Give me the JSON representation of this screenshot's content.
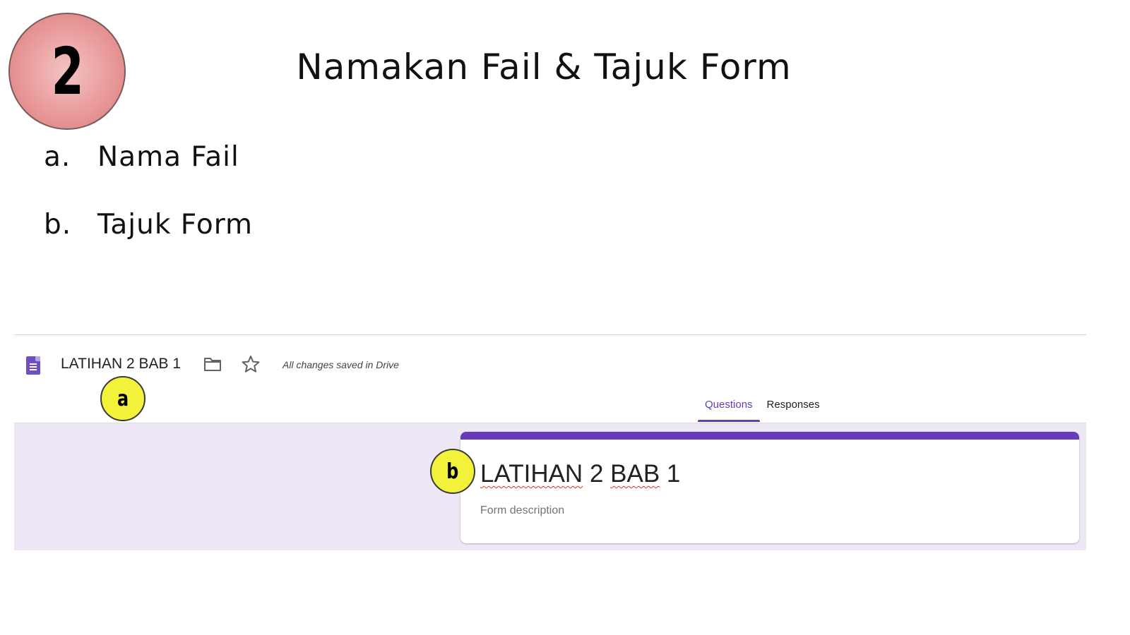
{
  "slide": {
    "step_number": "2",
    "title": "Namakan Fail & Tajuk Form",
    "steps": [
      {
        "marker": "a.",
        "text": "Nama Fail"
      },
      {
        "marker": "b.",
        "text": "Tajuk Form"
      }
    ]
  },
  "forms_screenshot": {
    "header": {
      "app_icon": "google-forms-icon",
      "document_name": "LATIHAN 2 BAB 1",
      "folder_icon": "folder-icon",
      "star_icon": "star-icon",
      "save_status": "All changes saved in Drive"
    },
    "tabs": [
      {
        "label": "Questions",
        "active": true
      },
      {
        "label": "Responses",
        "active": false
      }
    ],
    "form_card": {
      "title_part1": "LATIHAN",
      "title_part2": " 2 ",
      "title_part3": "BAB",
      "title_part4": " 1",
      "description_placeholder": "Form description"
    }
  },
  "callouts": {
    "a": "a",
    "b": "b"
  },
  "colors": {
    "forms_purple": "#673ab7",
    "form_background": "#ede7f6",
    "callout_yellow": "#f3f23a",
    "badge_pink": "#e99a9a"
  }
}
